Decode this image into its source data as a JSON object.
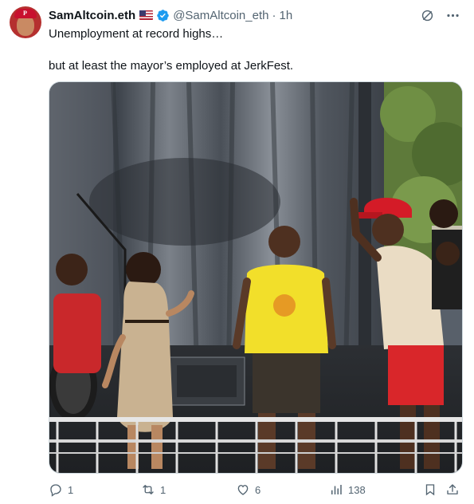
{
  "author": {
    "display_name": "SamAltcoin.eth",
    "handle": "@SamAltcoin_eth",
    "separator": "·",
    "time_ago": "1h",
    "flag_icon": "us-flag-icon",
    "verified_icon": "verified-badge-icon",
    "verified_color": "#1d9bf0",
    "avatar_icon": "avatar-phillies-cap"
  },
  "tweet": {
    "line1": "Unemployment at record highs…",
    "line2": "but at least the mayor’s employed at JerkFest."
  },
  "media": {
    "kind": "video-still",
    "description_icon": "stage-performance-image"
  },
  "actions": {
    "reply_count": "1",
    "repost_count": "1",
    "like_count": "6",
    "views_count": "138"
  },
  "colors": {
    "text": "#0f1419",
    "secondary": "#536471",
    "accent": "#1d9bf0"
  }
}
